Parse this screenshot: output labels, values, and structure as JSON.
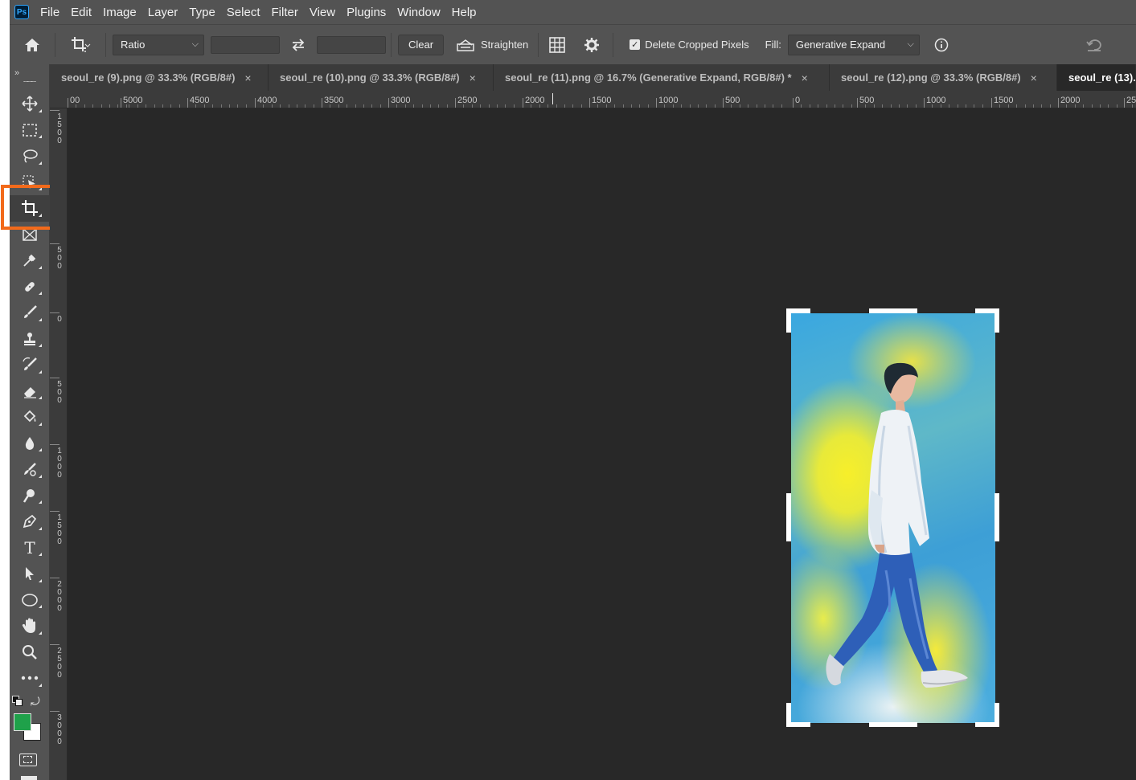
{
  "app": {
    "logo": "Ps"
  },
  "menu": [
    "File",
    "Edit",
    "Image",
    "Layer",
    "Type",
    "Select",
    "Filter",
    "View",
    "Plugins",
    "Window",
    "Help"
  ],
  "options": {
    "home_icon": "home-icon",
    "crop_tool_icon": "crop-icon",
    "ratio_value": "Ratio",
    "width_value": "",
    "height_value": "",
    "clear_label": "Clear",
    "straighten_label": "Straighten",
    "delete_cropped_label": "Delete Cropped Pixels",
    "delete_cropped_checked": true,
    "fill_label": "Fill:",
    "fill_value": "Generative Expand"
  },
  "tabs": [
    {
      "label": "seoul_re (9).png @ 33.3% (RGB/8#)",
      "close": "×",
      "active": false
    },
    {
      "label": "seoul_re (10).png @ 33.3% (RGB/8#)",
      "close": "×",
      "active": false
    },
    {
      "label": "seoul_re (11).png @ 16.7% (Generative Expand, RGB/8#) *",
      "close": "×",
      "active": false
    },
    {
      "label": "seoul_re (12).png @ 33.3% (RGB/8#)",
      "close": "×",
      "active": false
    },
    {
      "label": "seoul_re (13).",
      "close": "",
      "active": true
    }
  ],
  "ruler_top": [
    "00",
    "5000",
    "4500",
    "4000",
    "3500",
    "3000",
    "2500",
    "2000",
    "1500",
    "1000",
    "500",
    "0",
    "500",
    "1000",
    "1500",
    "2000",
    "25"
  ],
  "ruler_left": [
    [
      "1",
      "5",
      "0",
      "0"
    ],
    [
      "5",
      "0",
      "0"
    ],
    [
      "0"
    ],
    [
      "5",
      "0",
      "0"
    ],
    [
      "1",
      "0",
      "0",
      "0"
    ],
    [
      "1",
      "5",
      "0",
      "0"
    ],
    [
      "2",
      "0",
      "0",
      "0"
    ],
    [
      "2",
      "5",
      "0",
      "0"
    ],
    [
      "3",
      "0",
      "0",
      "0"
    ]
  ],
  "tools": [
    "move-icon",
    "marquee-icon",
    "lasso-icon",
    "object-select-icon",
    "crop-icon",
    "frame-icon",
    "eyedropper-icon",
    "healing-icon",
    "brush-icon",
    "stamp-icon",
    "history-brush-icon",
    "eraser-icon",
    "paint-bucket-icon",
    "blur-icon",
    "smudge-icon",
    "dodge-icon",
    "pen-icon",
    "type-icon",
    "path-select-icon",
    "ellipse-icon",
    "hand-icon",
    "zoom-icon",
    "more-icon"
  ],
  "type_tool_glyph": "T",
  "colors": {
    "foreground": "#1fa14a",
    "background": "#ffffff",
    "highlight": "#f26a1b"
  }
}
